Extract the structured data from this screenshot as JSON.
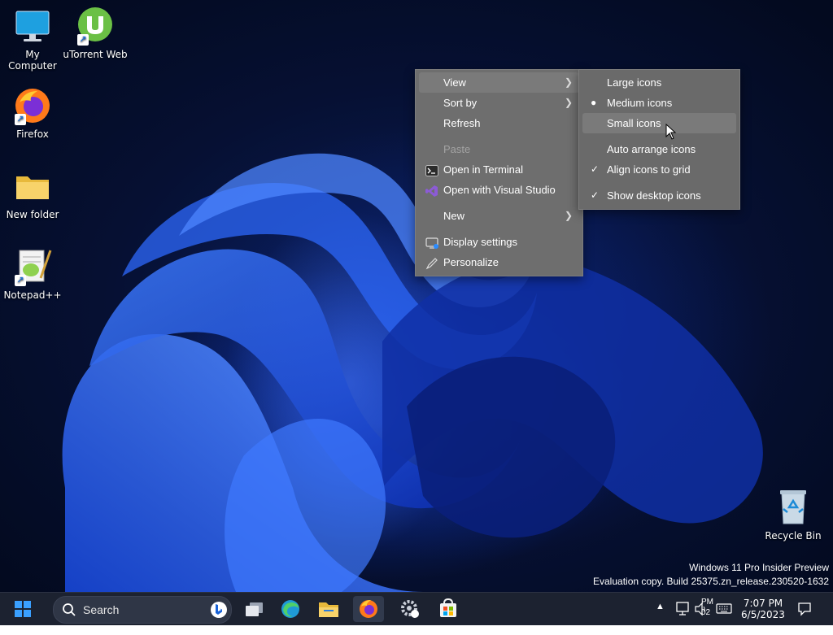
{
  "desktop_icons": [
    {
      "label": "My Computer"
    },
    {
      "label": "uTorrent Web"
    },
    {
      "label": "Firefox"
    },
    {
      "label": "New folder"
    },
    {
      "label": "Notepad++"
    },
    {
      "label": "Recycle Bin"
    }
  ],
  "context_menu": {
    "items": [
      {
        "label": "View",
        "has_submenu": true
      },
      {
        "label": "Sort by",
        "has_submenu": true
      },
      {
        "label": "Refresh"
      },
      {
        "label": "Paste",
        "disabled": true
      },
      {
        "label": "Open in Terminal",
        "icon": "terminal-icon"
      },
      {
        "label": "Open with Visual Studio",
        "icon": "visual-studio-icon"
      },
      {
        "label": "New",
        "has_submenu": true
      },
      {
        "label": "Display settings",
        "icon": "display-icon"
      },
      {
        "label": "Personalize",
        "icon": "pen-icon"
      }
    ]
  },
  "view_submenu": {
    "items": [
      {
        "label": "Large icons"
      },
      {
        "label": "Medium icons",
        "selected": true
      },
      {
        "label": "Small icons",
        "hovered": true
      },
      {
        "label": "Auto arrange icons"
      },
      {
        "label": "Align icons to grid",
        "checked": true
      },
      {
        "label": "Show desktop icons",
        "checked": true
      }
    ]
  },
  "watermark": {
    "line1": "Windows 11 Pro Insider Preview",
    "line2": "Evaluation copy. Build 25375.zn_release.230520-1632"
  },
  "taskbar": {
    "search_label": "Search",
    "apps": [
      "start-icon",
      "search-icon",
      "bing-icon",
      "task-view-icon",
      "edge-icon",
      "file-explorer-icon",
      "firefox-icon",
      "settings-icon",
      "store-icon"
    ],
    "tray_text_top": "PM",
    "tray_text_bottom": "02",
    "clock_time": "7:07 PM",
    "clock_date": "6/5/2023"
  },
  "colors": {
    "taskbar_bg": "#1c2230",
    "menu_bg": "#6e6e6e",
    "accent": "#2b6fe0"
  }
}
